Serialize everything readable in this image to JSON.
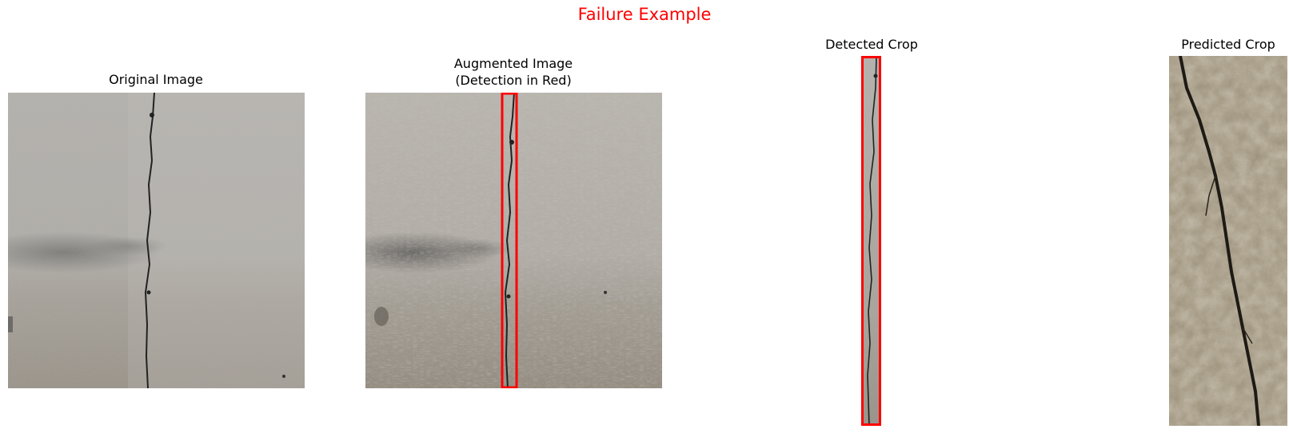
{
  "figure": {
    "suptitle": "Failure Example",
    "suptitle_color": "#ff0000",
    "detection_box_color": "#ff0000"
  },
  "panels": [
    {
      "title_lines": [
        "Original Image"
      ],
      "content": "concrete-wall-photo"
    },
    {
      "title_lines": [
        "Augmented Image",
        "(Detection in Red)"
      ],
      "content": "augmented-concrete-wall-photo-with-red-detection-box"
    },
    {
      "title_lines": [
        "Detected Crop"
      ],
      "content": "narrow-crop-of-crack-with-red-border"
    },
    {
      "title_lines": [
        "Predicted Crop"
      ],
      "content": "close-up-aggregate-concrete-crack-photo"
    }
  ]
}
